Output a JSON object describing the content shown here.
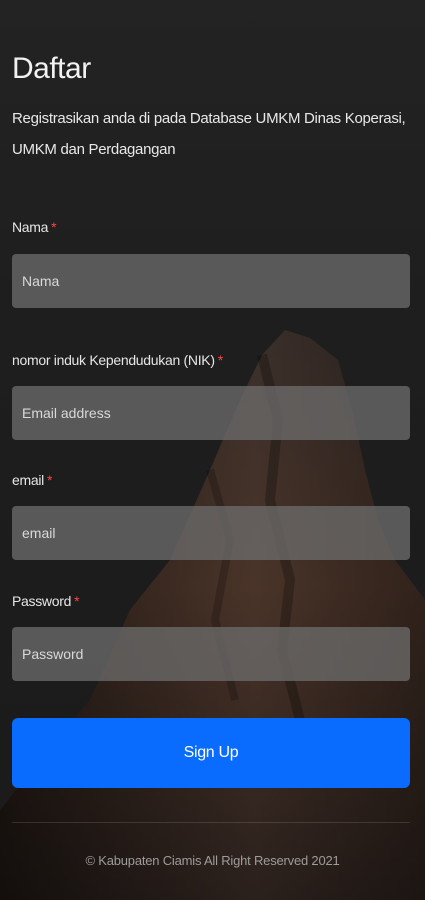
{
  "header": {
    "title": "Daftar",
    "subtitle": "Registrasikan anda di pada Database UMKM Dinas Koperasi, UMKM dan Perdagangan"
  },
  "form": {
    "required_marker": "*",
    "fields": [
      {
        "label": "Nama",
        "placeholder": "Nama",
        "value": ""
      },
      {
        "label": "nomor induk Kependudukan (NIK)",
        "placeholder": "Email address",
        "value": ""
      },
      {
        "label": "email",
        "placeholder": "email",
        "value": ""
      },
      {
        "label": "Password",
        "placeholder": "Password",
        "value": ""
      }
    ],
    "submit_label": "Sign Up"
  },
  "footer": {
    "copyright": "© Kabupaten Ciamis All Right Reserved 2021"
  },
  "colors": {
    "accent": "#0a6cff",
    "required": "#ff4444",
    "input_bg": "#6e6e6e"
  }
}
